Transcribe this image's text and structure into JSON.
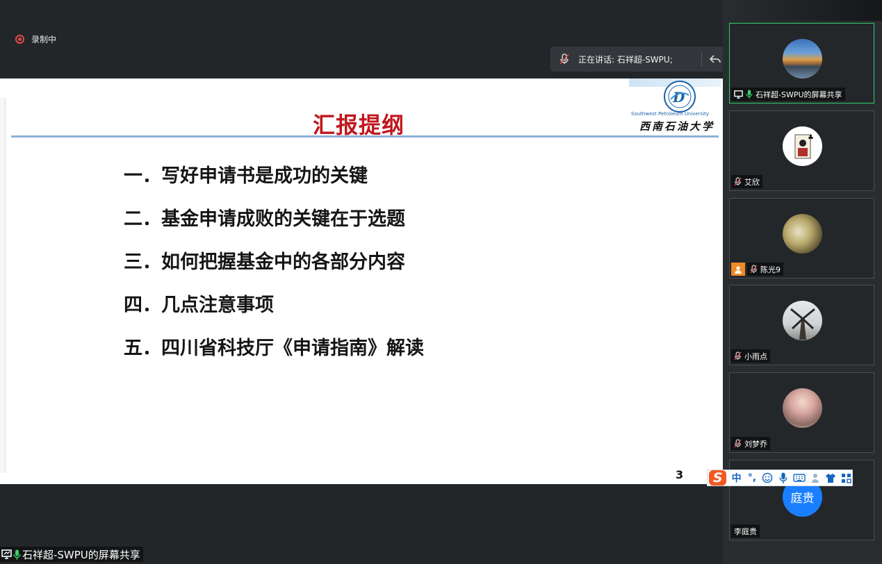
{
  "recording": {
    "label": "录制中"
  },
  "speaking": {
    "label": "正在讲话: 石祥超-SWPU;"
  },
  "slide": {
    "title": "汇报提纲",
    "logo_text_en": "Southwest Petroleum University",
    "logo_text_cn": "西南石油大学",
    "items": [
      "一．写好申请书是成功的关键",
      "二．基金申请成败的关键在于选题",
      "三．如何把握基金中的各部分内容",
      "四．几点注意事项",
      "五．四川省科技厅《申请指南》解读"
    ],
    "page_number": "3"
  },
  "share_banner": {
    "label": "石祥超-SWPU的屏幕共享"
  },
  "participants": [
    {
      "name": "石祥超-SWPU的屏幕共享",
      "avatar_icon": "mountain-photo-icon"
    },
    {
      "name": "艾欣",
      "avatar_icon": "playing-card-icon"
    },
    {
      "name": "陈光9",
      "avatar_icon": "tea-photo-icon"
    },
    {
      "name": "小雨点",
      "avatar_icon": "windmill-photo-icon"
    },
    {
      "name": "刘梦乔",
      "avatar_icon": "child-photo-icon"
    },
    {
      "name": "李庭贵",
      "avatar_text": "庭贵"
    }
  ],
  "ime": {
    "mode": "中",
    "punct": "°,"
  },
  "colors": {
    "title_red": "#c0161c",
    "active_border": "#2fcf6a",
    "avatar_blue": "#1a7fff",
    "rec_red": "#e34b4b"
  }
}
